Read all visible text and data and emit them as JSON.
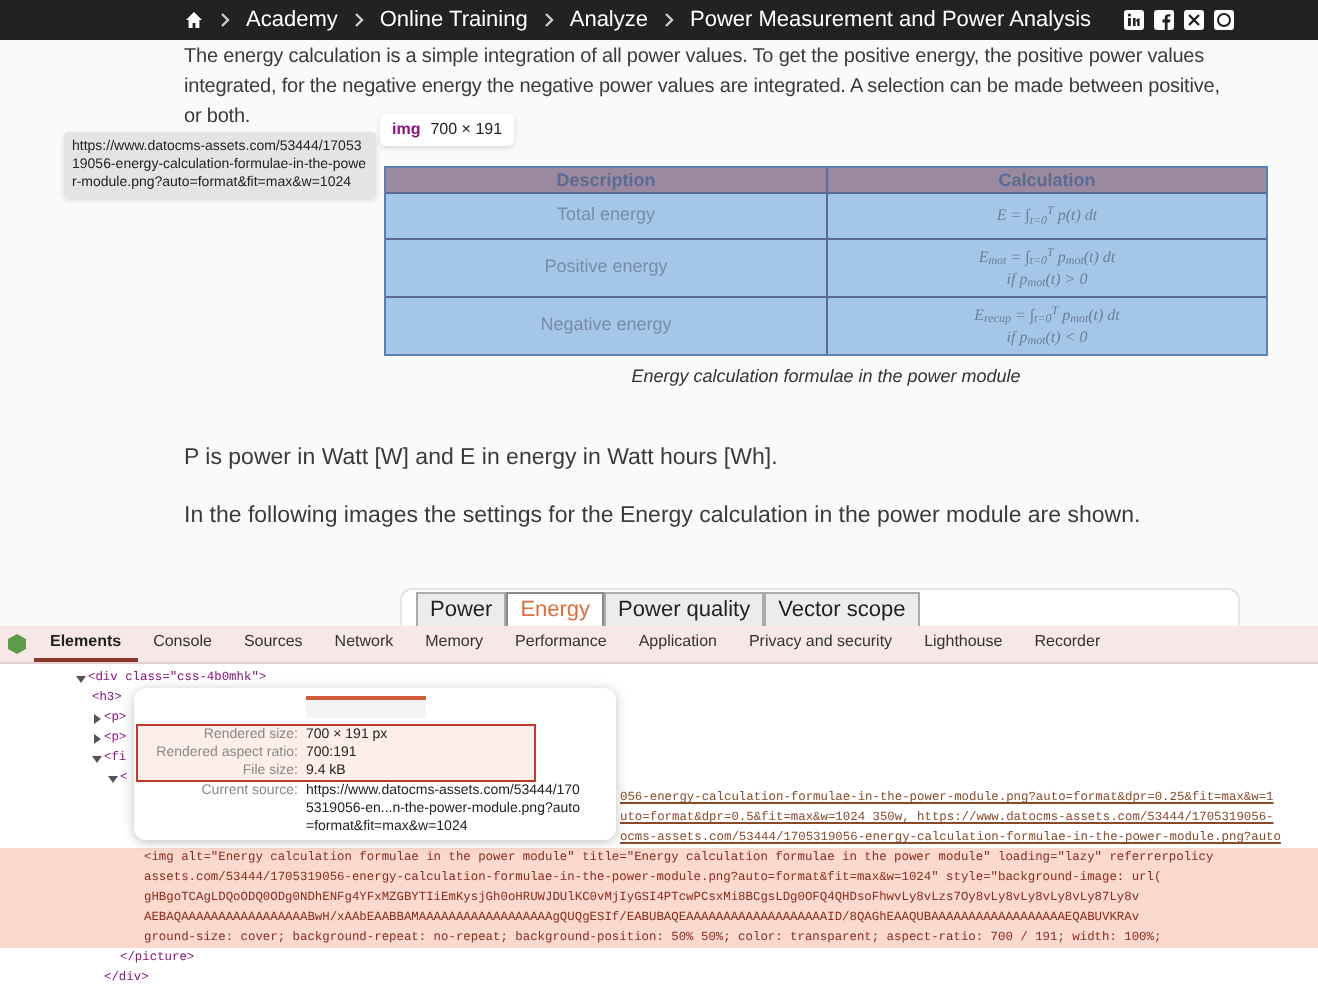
{
  "breadcrumbs": [
    "Academy",
    "Online Training",
    "Analyze",
    "Power Measurement and Power Analysis"
  ],
  "article": {
    "intro": [
      "The energy calculation is a simple integration of all power values. To get the positive energy, the positive power values",
      "integrated, for the negative energy the negative power values are integrated. A selection can be made between positive,",
      "or both."
    ],
    "url_tooltip": "https://www.datocms-assets.com/53444/1705319056-energy-calculation-formulae-in-the-power-module.png?auto=format&fit=max&w=1024",
    "img_badge": {
      "tag": "img",
      "size": "700 × 191"
    },
    "table": {
      "columns": [
        "Description",
        "Calculation"
      ],
      "rows": [
        {
          "description": "Total energy",
          "formula": [
            "E = ∫$_{t=0}$$^{T}$ p(t) dt"
          ]
        },
        {
          "description": "Positive energy",
          "formula": [
            "E$_{mot}$ = ∫$_{t=0}$$^{T}$ p$_{mot}$(t) dt",
            "if p$_{mot}$(t) > 0"
          ]
        },
        {
          "description": "Negative energy",
          "formula": [
            "E$_{recup}$ = ∫$_{t=0}$$^{T}$ p$_{mot}$(t) dt",
            "if p$_{mot}$(t) < 0"
          ]
        }
      ]
    },
    "caption": "Energy calculation formulae in the power module",
    "paragraphs": [
      "P is power in Watt [W] and E in energy in Watt hours [Wh].",
      "In the following images the settings for the Energy calculation in the power module are shown."
    ],
    "settings_tabs": [
      {
        "label": "Power",
        "selected": false
      },
      {
        "label": "Energy",
        "selected": true
      },
      {
        "label": "Power quality",
        "selected": false
      },
      {
        "label": "Vector scope",
        "selected": false
      }
    ]
  },
  "devtools": {
    "tabs": [
      {
        "label": "Elements",
        "selected": true
      },
      {
        "label": "Console",
        "selected": false
      },
      {
        "label": "Sources",
        "selected": false
      },
      {
        "label": "Network",
        "selected": false
      },
      {
        "label": "Memory",
        "selected": false
      },
      {
        "label": "Performance",
        "selected": false
      },
      {
        "label": "Application",
        "selected": false
      },
      {
        "label": "Privacy and security",
        "selected": false
      },
      {
        "label": "Lighthouse",
        "selected": false
      },
      {
        "label": "Recorder",
        "selected": false
      }
    ],
    "tree": [
      {
        "text": "<div class=\"css-4b0mhk\">",
        "expanded": true,
        "children": [
          {
            "text": "<h3>"
          },
          {
            "text": "<p>",
            "expanded": false
          },
          {
            "text": "<p>",
            "expanded": false
          },
          {
            "text": "<fi",
            "expanded": true,
            "close": "</div>",
            "children": [
              {
                "text": "<",
                "expanded": true,
                "close": "</picture>",
                "children": [
                  {
                    "kind": "source",
                    "lines": [
                      "056-energy-calculation-formulae-in-the-power-module.png?auto=format&dpr=0.25&fit=max&w=1",
                      "uto=format&dpr=0.5&fit=max&w=1024 350w, https://www.datocms-assets.com/53444/1705319056-",
                      "ocms-assets.com/53444/1705319056-energy-calculation-formulae-in-the-power-module.png?auto"
                    ]
                  },
                  {
                    "kind": "img",
                    "selected": true,
                    "lines": [
                      "<img alt=\"Energy calculation formulae in the power module\" title=\"Energy calculation formulae in the power module\" loading=\"lazy\" referrerpolicy",
                      "assets.com/53444/1705319056-energy-calculation-formulae-in-the-power-module.png?auto=format&fit=max&w=1024\" style=\"background-image: url(",
                      "gHBgoTCAgLDQoODQ0ODg0NDhENFg4YFxMZGBYTIiEmKysjGh0oHRUWJDUlKC0vMjIyGSI4PTcwPCsxMi8BCgsLDg0OFQ4QHDsoFhwvLy8vLzs7Oy8vLy8vLy8vLy8vLy87Ly8v",
                      "AEBAQAAAAAAAAAAAAAAAAABwH/xAAbEAABBAMAAAAAAAAAAAAAAAAAAgQUQgESIf/EABUBAQEAAAAAAAAAAAAAAAAAAAID/8QAGhEAAQUBAAAAAAAAAAAAAAAAAAEQABUVKRAv",
                      "ground-size: cover; background-repeat: no-repeat; background-position: 50% 50%; color: transparent; aspect-ratio: 700 / 191; width: 100%;"
                    ]
                  }
                ]
              }
            ]
          }
        ]
      }
    ],
    "image_tooltip": {
      "rows": [
        {
          "label": "Rendered size:",
          "value": "700 × 191 px",
          "highlighted": true
        },
        {
          "label": "Rendered aspect ratio:",
          "value": "700:191",
          "highlighted": true
        },
        {
          "label": "File size:",
          "value": "9.4 kB",
          "highlighted": true
        },
        {
          "label": "Current source:",
          "value": "https://www.datocms-assets.com/53444/1705319056-en...n-the-power-module.png?auto=format&fit=max&w=1024",
          "highlighted": false
        }
      ]
    }
  }
}
